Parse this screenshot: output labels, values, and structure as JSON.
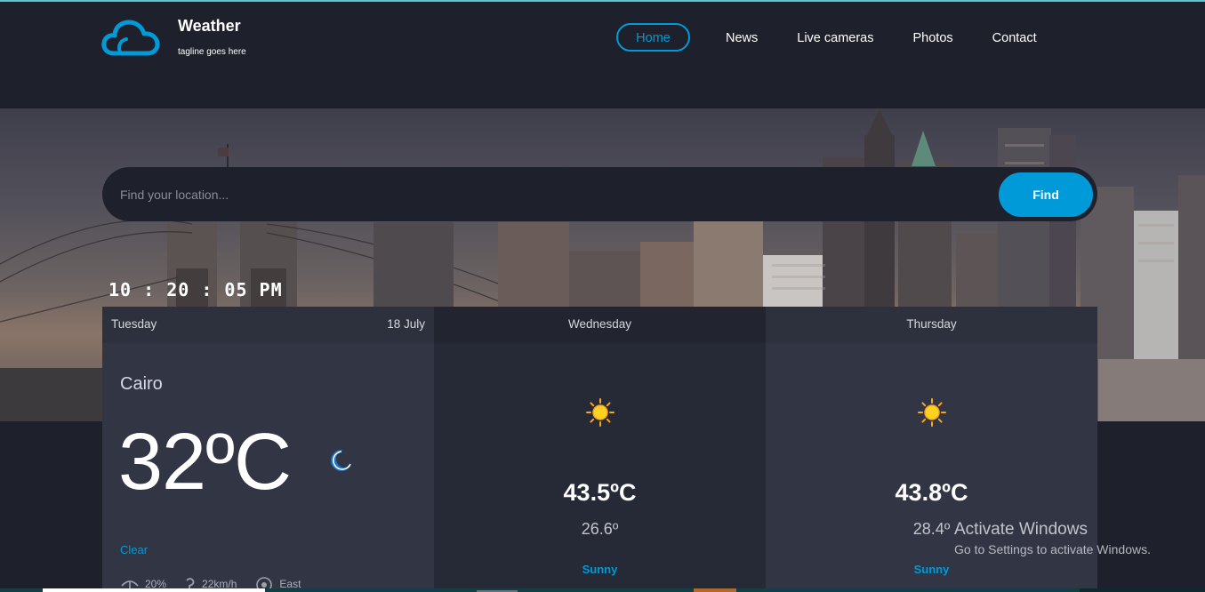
{
  "brand": {
    "name": "Weather",
    "tagline": "tagline goes here",
    "icon": "cloud-icon"
  },
  "nav": {
    "items": [
      "Home",
      "News",
      "Live cameras",
      "Photos",
      "Contact"
    ],
    "active": "Home"
  },
  "search": {
    "placeholder": "Find your location...",
    "value": "",
    "button_label": "Find"
  },
  "clock": "10 : 20 : 05 PM",
  "today": {
    "day": "Tuesday",
    "date": "18 July",
    "city": "Cairo",
    "temp": "32ºC",
    "icon": "moon-icon",
    "condition": "Clear",
    "humidity": "20%",
    "wind": "22km/h",
    "direction": "East"
  },
  "forecast": [
    {
      "day": "Wednesday",
      "icon": "sun-icon",
      "max": "43.5ºC",
      "min": "26.6º",
      "condition": "Sunny"
    },
    {
      "day": "Thursday",
      "icon": "sun-icon",
      "max": "43.8ºC",
      "min": "28.4º",
      "condition": "Sunny"
    }
  ],
  "watermark": {
    "title": "Activate Windows",
    "subtitle": "Go to Settings to activate Windows."
  },
  "colors": {
    "accent": "#009ad8",
    "background": "#1e202b",
    "card": "#323544",
    "card_alt": "#262936"
  }
}
